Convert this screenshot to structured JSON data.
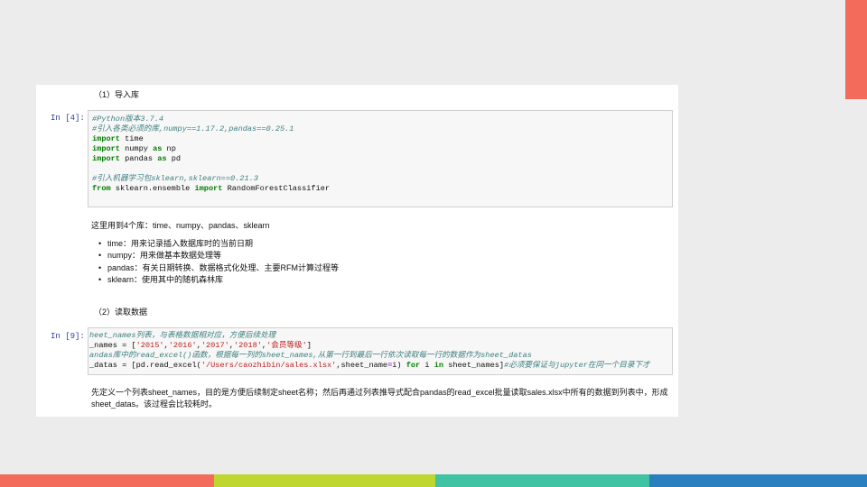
{
  "section1_heading": "（1）导入库",
  "cell1": {
    "prompt": "In [4]:",
    "lines": [
      {
        "comment": "#Python版本3.7.4"
      },
      {
        "comment": "#引入各类必须的库,numpy==1.17.2,pandas==0.25.1"
      },
      {
        "kw": "import",
        "rest": " time"
      },
      {
        "kw": "import",
        "rest": " numpy ",
        "kw2": "as",
        "rest2": " np"
      },
      {
        "kw": "import",
        "rest": " pandas ",
        "kw2": "as",
        "rest2": " pd"
      },
      {},
      {
        "comment": "#引入机器学习包sklearn,sklearn==0.21.3"
      },
      {
        "kw": "from",
        "rest": " sklearn.ensemble ",
        "kw2": "import",
        "rest2": " RandomForestClassifier"
      }
    ]
  },
  "libs_intro": "这里用到4个库：time、numpy、pandas、sklearn",
  "libs": [
    "time：用来记录插入数据库时的当前日期",
    "numpy：用来做基本数据处理等",
    "pandas：有关日期转换、数据格式化处理、主要RFM计算过程等",
    "sklearn：使用其中的随机森林库"
  ],
  "section2_heading": "（2）读取数据",
  "cell2": {
    "prompt": "In [9]:",
    "line1": "heet_names列表，与表格数据相对应，方便后续处理",
    "line2_prefix": "_names = [",
    "line2_strings": [
      "'2015'",
      "'2016'",
      "'2017'",
      "'2018'",
      "'会员等级'"
    ],
    "line2_suffix": "]",
    "line3": "andas库中的read_excel()函数，根据每一列的sheet_names,从第一行到最后一行依次读取每一行的数据作为sheet_datas",
    "line4_a": "_datas = [pd.read_excel(",
    "line4_path": "'/Users/caozhibin/sales.xlsx'",
    "line4_b": ",sheet_name",
    "line4_eq": "=",
    "line4_c": "i) ",
    "line4_for": "for",
    "line4_d": " i ",
    "line4_in": "in",
    "line4_e": " sheet_names]",
    "line4_comment": "#必须要保证与jupyter在同一个目录下才"
  },
  "read_desc": "先定义一个列表sheet_names，目的是方便后续制定sheet名称；然后再通过列表推导式配合pandas的read_excel批量读取sales.xlsx中所有的数据到列表中，形成sheet_datas。该过程会比较耗时。",
  "colors": {
    "accent_red": "#f26b5b",
    "accent_green": "#bfd630",
    "accent_teal": "#3fc3a3",
    "accent_blue": "#2a7fbf",
    "prompt": "#303f9f",
    "keyword": "#008000",
    "comment": "#408080",
    "string": "#ba2121"
  }
}
